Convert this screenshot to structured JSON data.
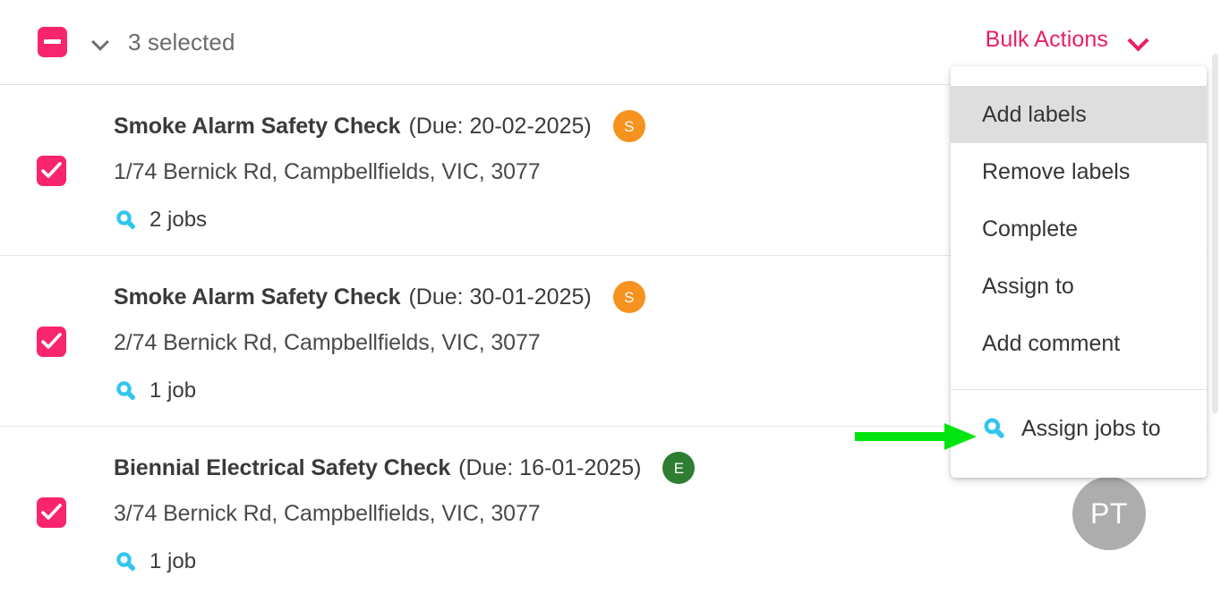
{
  "header": {
    "master_checkbox_state": "indeterminate",
    "expand_icon": "chevron-down-icon",
    "selected_label": "3 selected",
    "bulk_actions_label": "Bulk Actions",
    "bulk_actions_icon": "chevron-down-icon",
    "accent_pink": "#ea1e63",
    "checkbox_pink": "#f9246e"
  },
  "menu": {
    "items": [
      {
        "label": "Add labels",
        "active": true,
        "icon": null
      },
      {
        "label": "Remove labels",
        "active": false,
        "icon": null
      },
      {
        "label": "Complete",
        "active": false,
        "icon": null
      },
      {
        "label": "Assign to",
        "active": false,
        "icon": null
      },
      {
        "label": "Add comment",
        "active": false,
        "icon": null
      }
    ],
    "footer_item": {
      "label": "Assign jobs to",
      "icon": "wrench-icon"
    },
    "highlight_color": "#dedede"
  },
  "list": {
    "rows": [
      {
        "checked": true,
        "title": "Smoke Alarm Safety Check",
        "due": "(Due: 20-02-2025)",
        "avatar_initial": "S",
        "avatar_color": "#f6921e",
        "address": "1/74 Bernick Rd, Campbellfields, VIC, 3077",
        "jobs_icon": "wrench-icon",
        "jobs_label": "2 jobs"
      },
      {
        "checked": true,
        "title": "Smoke Alarm Safety Check",
        "due": "(Due: 30-01-2025)",
        "avatar_initial": "S",
        "avatar_color": "#f6921e",
        "address": "2/74 Bernick Rd, Campbellfields, VIC, 3077",
        "jobs_icon": "wrench-icon",
        "jobs_label": "1 job"
      },
      {
        "checked": true,
        "title": "Biennial Electrical Safety Check",
        "due": "(Due: 16-01-2025)",
        "avatar_initial": "E",
        "avatar_color": "#2e7d32",
        "address": "3/74 Bernick Rd, Campbellfields, VIC, 3077",
        "jobs_icon": "wrench-icon",
        "jobs_label": "1 job"
      }
    ]
  },
  "annotation": {
    "arrow_icon": "right-arrow-annotation",
    "arrow_color": "#00e510"
  },
  "user_badge": {
    "initials": "PT",
    "color": "#adadad"
  },
  "icons": {
    "wrench_color": "#31c5ef"
  }
}
